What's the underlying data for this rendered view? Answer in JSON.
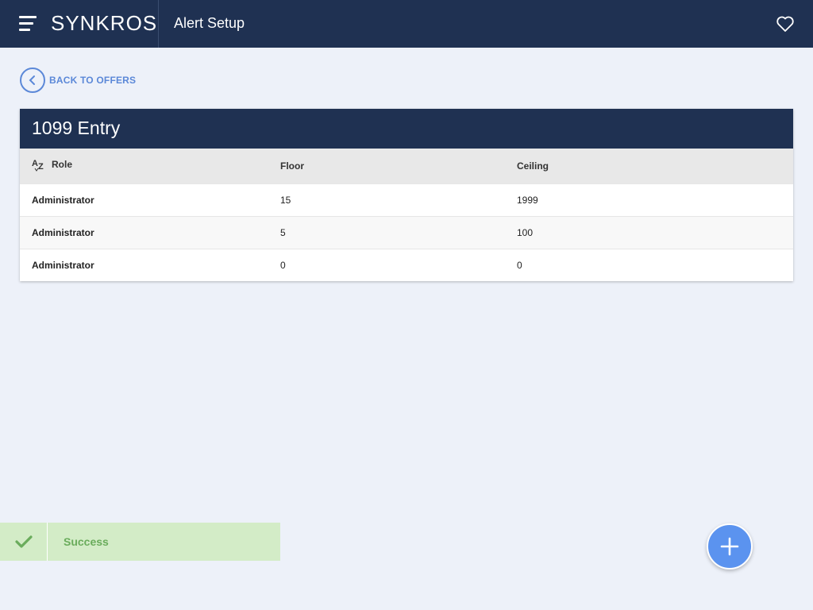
{
  "header": {
    "logo": "SYNKROS",
    "title": "Alert Setup",
    "menu_icon": "hamburger-menu-icon",
    "favorite_icon": "heart-icon"
  },
  "back": {
    "label": "BACK TO OFFERS",
    "icon": "chevron-left-icon"
  },
  "card": {
    "title": "1099 Entry",
    "columns": [
      "Role",
      "Floor",
      "Ceiling"
    ],
    "sort_icon": "az-sort-icon",
    "rows": [
      {
        "role": "Administrator",
        "floor": "15",
        "ceiling": "1999"
      },
      {
        "role": "Administrator",
        "floor": "5",
        "ceiling": "100"
      },
      {
        "role": "Administrator",
        "floor": "0",
        "ceiling": "0"
      }
    ]
  },
  "toast": {
    "message": "Success",
    "icon": "checkmark-icon"
  },
  "fab": {
    "icon": "plus-icon"
  },
  "colors": {
    "header_bg": "#1f3152",
    "page_bg": "#edf1f9",
    "accent": "#5b88d8",
    "fab": "#5b93ef",
    "success_bg": "#d3ecc7",
    "success_text": "#6aac5c"
  }
}
